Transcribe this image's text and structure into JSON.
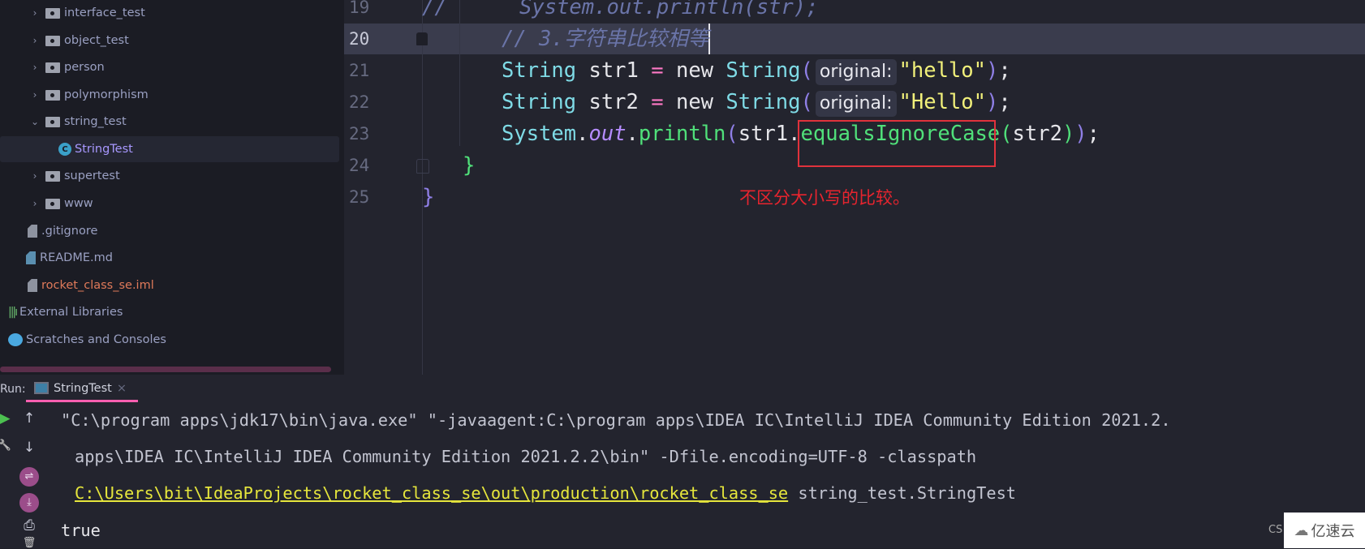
{
  "sidebar": {
    "items": [
      {
        "label": "interface_test",
        "type": "folder",
        "expanded": false
      },
      {
        "label": "object_test",
        "type": "folder",
        "expanded": false
      },
      {
        "label": "person",
        "type": "folder",
        "expanded": false
      },
      {
        "label": "polymorphism",
        "type": "folder",
        "expanded": false
      },
      {
        "label": "string_test",
        "type": "folder",
        "expanded": true
      },
      {
        "label": "StringTest",
        "type": "class",
        "selected": true
      },
      {
        "label": "supertest",
        "type": "folder",
        "expanded": false
      },
      {
        "label": "www",
        "type": "folder",
        "expanded": false
      },
      {
        "label": ".gitignore",
        "type": "file"
      },
      {
        "label": "README.md",
        "type": "file"
      },
      {
        "label": "rocket_class_se.iml",
        "type": "file"
      },
      {
        "label": "External Libraries",
        "type": "libraries"
      },
      {
        "label": "Scratches and Consoles",
        "type": "scratches"
      }
    ]
  },
  "editor": {
    "line_numbers": [
      "19",
      "20",
      "21",
      "22",
      "23",
      "24",
      "25"
    ],
    "current_line": "20",
    "lines": {
      "l19_prefix": "//",
      "l19_code": "System.out.println(str);",
      "l20": "// 3.字符串比较相等",
      "l21": {
        "type": "String",
        "var": " str1 ",
        "eq": "=",
        "new": " new ",
        "ctor": "String",
        "open": "(",
        "hint": "original:",
        "str": "\"hello\"",
        "close": ")",
        "semi": ";"
      },
      "l22": {
        "type": "String",
        "var": " str2 ",
        "eq": "=",
        "new": " new ",
        "ctor": "String",
        "open": "(",
        "hint": "original:",
        "str": "\"Hello\"",
        "close": ")",
        "semi": ";"
      },
      "l23": {
        "cls": "System",
        "dot1": ".",
        "field": "out",
        "dot2": ".",
        "method": "println",
        "open": "(",
        "arg": "str1",
        "dot3": ".",
        "call": "equalsIgnoreCase",
        "open2": "(",
        "arg2": "str2",
        "close2": ")",
        "close": ")",
        "semi": ";"
      },
      "l24": "}",
      "l25": "}"
    },
    "annotation": "不区分大小写的比较。"
  },
  "run": {
    "label": "Run:",
    "tab": "StringTest",
    "tab_close": "×",
    "console": {
      "line1": "\"C:\\program apps\\jdk17\\bin\\java.exe\" \"-javaagent:C:\\program apps\\IDEA IC\\IntelliJ IDEA Community Edition 2021.2.",
      "line2": "apps\\IDEA IC\\IntelliJ IDEA Community Edition 2021.2.2\\bin\" -Dfile.encoding=UTF-8 -classpath",
      "line3_link": "C:\\Users\\bit\\IdeaProjects\\rocket_class_se\\out\\production\\rocket_class_se",
      "line3_rest": " string_test.StringTest",
      "line4": "true"
    },
    "toolbar": {
      "up": "↑",
      "down": "↓",
      "run": "▶",
      "wrench": "🔧",
      "soft_wrap": "⇌",
      "scroll_end": "⤓",
      "print": "⎙",
      "delete": "🗑"
    }
  },
  "watermark": {
    "prefix": "CS",
    "brand": "亿速云"
  }
}
